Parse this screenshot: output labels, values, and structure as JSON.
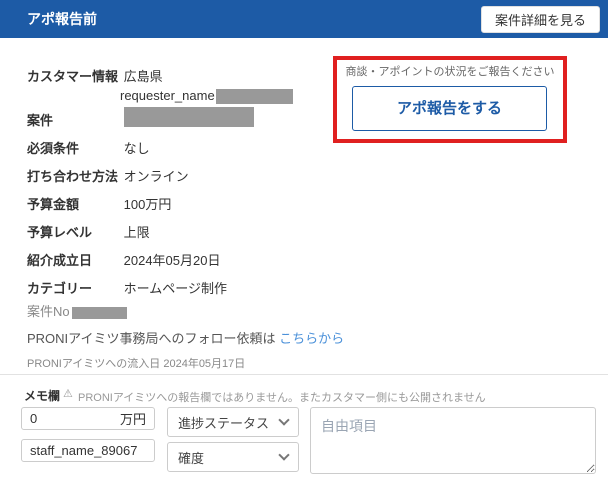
{
  "header": {
    "title": "アポ報告前",
    "detail_button_label": "案件詳細を見る"
  },
  "report_panel": {
    "prompt": "商談・アポイントの状況をご報告ください",
    "button_label": "アポ報告をする"
  },
  "info": {
    "rows": [
      {
        "label": "カスタマー情報",
        "value": "広島県",
        "value_line2": "requester_name",
        "value_line2_redacted": true
      },
      {
        "label": "案件",
        "value_redacted": true
      },
      {
        "label": "必須条件",
        "value": "なし"
      },
      {
        "label": "打ち合わせ方法",
        "value": "オンライン"
      },
      {
        "label": "予算金額",
        "value": "100万円"
      },
      {
        "label": "予算レベル",
        "value": "上限"
      },
      {
        "label": "紹介成立日",
        "value": "2024年05月20日"
      },
      {
        "label": "カテゴリー",
        "value": "ホームページ制作"
      }
    ],
    "case_no_label": "案件No",
    "case_no_redacted": true,
    "follow_text": "PRONIアイミツ事務局へのフォロー依頼は ",
    "follow_link_label": "こちらから",
    "inflow_text": "PRONIアイミツへの流入日 2024年05月17日"
  },
  "memo": {
    "label": "メモ欄",
    "warning_icon": "⚠",
    "notice": "PRONIアイミツへの報告欄ではありません。またカスタマー側にも公開されません",
    "amount_value": "0",
    "amount_suffix": "万円",
    "progress_select_label": "進捗ステータス",
    "staff_value": "staff_name_89067",
    "confidence_select_label": "確度",
    "free_text_placeholder": "自由項目"
  },
  "colors": {
    "header_blue": "#1d5ba6",
    "accent_blue": "#1d5ba6",
    "link_blue": "#4a90d9",
    "annotation_red": "#e02020",
    "redaction_gray": "#999999"
  }
}
